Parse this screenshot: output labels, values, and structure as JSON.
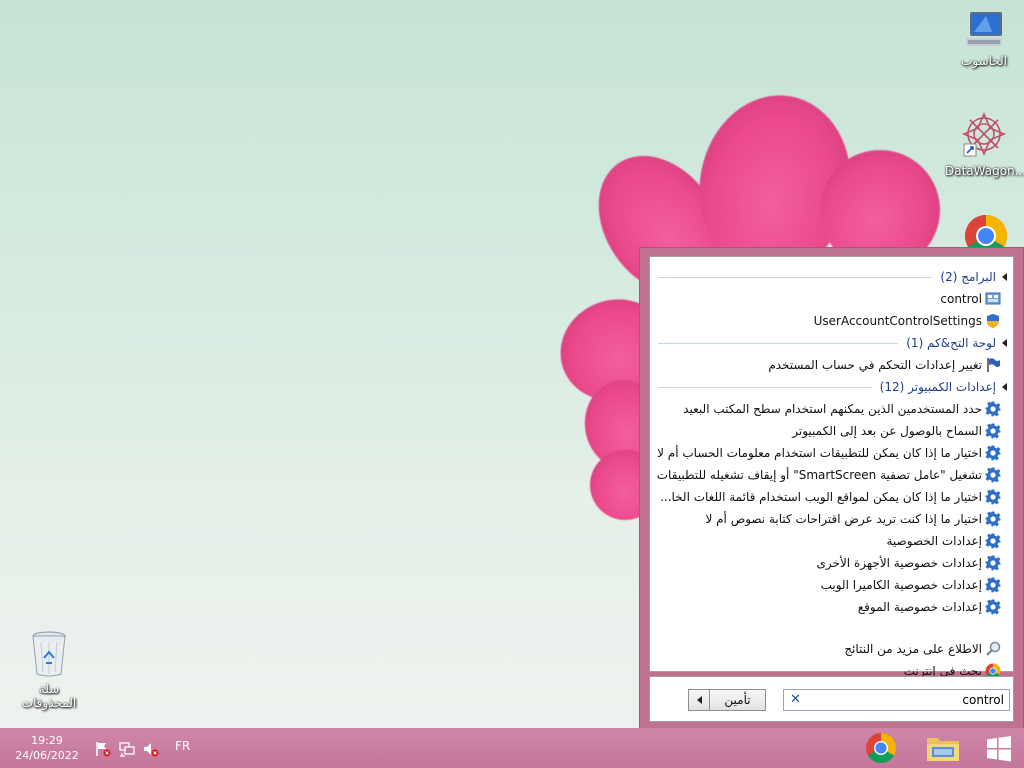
{
  "desktop": {
    "icons": [
      {
        "label": "الحاسوب",
        "icon": "computer-icon"
      },
      {
        "label": "DataWagon...",
        "icon": "datawagon-shortcut-icon"
      },
      {
        "label": "",
        "icon": "chrome-icon"
      },
      {
        "label": "سلة المحذوفات",
        "icon": "recycle-bin-icon"
      }
    ]
  },
  "search_panel": {
    "groups": [
      {
        "title": "البرامج (2)",
        "items": [
          {
            "label": "control",
            "icon": "control-panel-icon"
          },
          {
            "label": "UserAccountControlSettings",
            "icon": "uac-shield-icon"
          }
        ]
      },
      {
        "title": "لوحة التح&كم (1)",
        "items": [
          {
            "label": "تغيير إعدادات التحكم في حساب المستخدم",
            "icon": "action-flag-icon"
          }
        ]
      },
      {
        "title": "إعدادات الكمبيوتر (12)",
        "items": [
          {
            "label": "حدد المستخدمين الذين يمكنهم استخدام سطح المكتب البعيد",
            "icon": "gear-icon"
          },
          {
            "label": "السماح بالوصول عن بعد إلى الكمبيوتر",
            "icon": "gear-icon"
          },
          {
            "label": "اختيار ما إذا كان يمكن للتطبيقات استخدام معلومات الحساب أم لا",
            "icon": "gear-icon"
          },
          {
            "label": "تشغيل \"عامل تصفية SmartScreen\" أو إيقاف تشغيله للتطبيقات",
            "icon": "gear-icon"
          },
          {
            "label": "اختيار ما إذا كان يمكن لمواقع الويب استخدام قائمة اللغات الخا...",
            "icon": "gear-icon"
          },
          {
            "label": "اختيار ما إذا كنت تريد عرض اقتراحات كتابة نصوص أم لا",
            "icon": "gear-icon"
          },
          {
            "label": "إعدادات الخصوصية",
            "icon": "gear-icon"
          },
          {
            "label": "إعدادات خصوصية الأجهزة الأخرى",
            "icon": "gear-icon"
          },
          {
            "label": "إعدادات خصوصية الكاميرا الويب",
            "icon": "gear-icon"
          },
          {
            "label": "إعدادات خصوصية الموقع",
            "icon": "gear-icon"
          }
        ]
      }
    ],
    "more_results": {
      "label": "الاطلاع على مزيد من النتائج",
      "icon": "magnifier-icon"
    },
    "web_search": {
      "label": "بحث في إنترنت",
      "icon": "chrome-icon"
    },
    "search_value": "control",
    "clear_label": "✕",
    "shutdown_label": "تأمين"
  },
  "taskbar": {
    "time": "19:29",
    "date": "24/06/2022",
    "language": "FR",
    "tray_icons": [
      "action-center-flag-icon",
      "network-icon",
      "volume-muted-icon"
    ],
    "pinned": [
      "chrome-icon",
      "file-explorer-icon"
    ],
    "start": "windows-start-icon"
  },
  "colors": {
    "taskbar": "#c77d9f",
    "panel_frame": "#c0718f",
    "group_header_text": "#1e3d8f"
  }
}
